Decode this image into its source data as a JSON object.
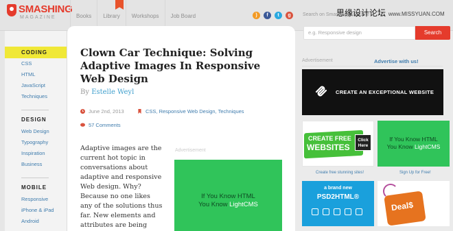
{
  "header": {
    "logo_line1": "SMASHING",
    "logo_line2": "MAGAZINE",
    "nav": [
      "Books",
      "Library",
      "Workshops",
      "Job Board"
    ],
    "search_hint": "Search on Smashing Magazine",
    "watermark_cn": "思缘设计论坛",
    "watermark_url": "www.MISSYUAN.COM",
    "social_icons": [
      "rss-icon",
      "facebook-icon",
      "twitter-icon",
      "googleplus-icon"
    ]
  },
  "sidebar": {
    "sections": [
      {
        "heading": "CODING",
        "items": [
          "CSS",
          "HTML",
          "JavaScript",
          "Techniques"
        ]
      },
      {
        "heading": "DESIGN",
        "items": [
          "Web Design",
          "Typography",
          "Inspiration",
          "Business"
        ]
      },
      {
        "heading": "MOBILE",
        "items": [
          "Responsive",
          "iPhone & iPad",
          "Android"
        ]
      }
    ]
  },
  "article": {
    "title": "Clown Car Technique: Solving Adaptive Images In Responsive Web Design",
    "by": "By",
    "author": "Estelle Weyl",
    "date": "June 2nd, 2013",
    "categories": "CSS, Responsive Web Design, Techniques",
    "comments": "57 Comments",
    "body": "Adaptive images are the current hot topic in conversations about adaptive and responsive Web design. Why? Because no one likes any of the solutions thus far. New elements and attributes are being discussed as a",
    "ad_label": "Advertisement",
    "ad_line1": "If You Know HTML",
    "ad_line2_prefix": "You Know ",
    "ad_line2_brand": "LightCMS"
  },
  "rail": {
    "search_placeholder": "e.g. Responsive design",
    "search_button": "Search",
    "ad_label": "Advertisement",
    "advertise_link": "Advertise with us!",
    "banner_text": "CREATE AN EXCEPTIONAL WEBSITE",
    "tile1_line1": "CREATE FREE",
    "tile1_line2": "WEBSITES",
    "tile1_click": "Click Here",
    "tile1_caption": "Create free stunning sites!",
    "tile2_line1": "If You Know HTML",
    "tile2_line2_prefix": "You Know ",
    "tile2_line2_brand": "LightCMS",
    "tile2_caption": "Sign Up for Free!",
    "tile3_line1": "a brand new",
    "tile3_line2": "PSD2HTML®",
    "tile4_text": "Deal$"
  },
  "colors": {
    "brand_red": "#e53b2c",
    "link_blue": "#3f7cad",
    "highlight_yellow": "#f0e837",
    "ad_green": "#30c45a"
  }
}
